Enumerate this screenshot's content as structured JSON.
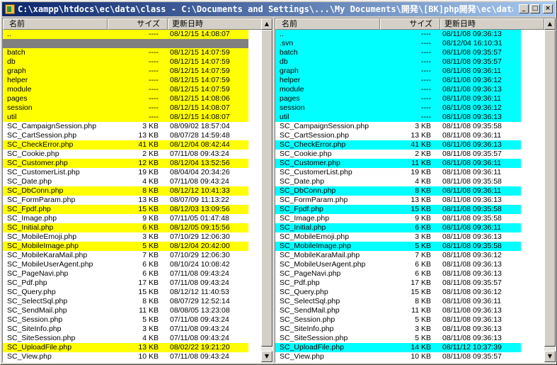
{
  "window": {
    "title": "C:\\xampp\\htdocs\\ec\\data\\class  - C:\\Documents and Settings\\...\\My Documents\\開発\\[BK]php開発\\ec\\data\\cla...",
    "minimize": "_",
    "maximize": "□",
    "close": "×"
  },
  "colors": {
    "left_highlight": "#ffff00",
    "right_highlight": "#00ffff",
    "selection": "#808080"
  },
  "headers": {
    "name": "名前",
    "size": "サイズ",
    "date": "更新日時"
  },
  "scroll": {
    "up": "▲",
    "down": "▼"
  },
  "left_rows": [
    {
      "name": "..",
      "size": "----",
      "date": "08/12/15 14:08:07",
      "hl": true
    },
    {
      "name": "",
      "size": "",
      "date": "",
      "sel": true
    },
    {
      "name": "batch",
      "size": "----",
      "date": "08/12/15 14:07:59",
      "hl": true
    },
    {
      "name": "db",
      "size": "----",
      "date": "08/12/15 14:07:59",
      "hl": true
    },
    {
      "name": "graph",
      "size": "----",
      "date": "08/12/15 14:07:59",
      "hl": true
    },
    {
      "name": "helper",
      "size": "----",
      "date": "08/12/15 14:07:59",
      "hl": true
    },
    {
      "name": "module",
      "size": "----",
      "date": "08/12/15 14:07:59",
      "hl": true
    },
    {
      "name": "pages",
      "size": "----",
      "date": "08/12/15 14:08:06",
      "hl": true
    },
    {
      "name": "session",
      "size": "----",
      "date": "08/12/15 14:08:07",
      "hl": true
    },
    {
      "name": "util",
      "size": "----",
      "date": "08/12/15 14:08:07",
      "hl": true
    },
    {
      "name": "SC_CampaignSession.php",
      "size": "3 KB",
      "date": "08/09/02 18:57:04",
      "hl": false
    },
    {
      "name": "SC_CartSession.php",
      "size": "13 KB",
      "date": "08/07/28 14:59:48",
      "hl": false
    },
    {
      "name": "SC_CheckError.php",
      "size": "41 KB",
      "date": "08/12/04 08:42:44",
      "hl": true
    },
    {
      "name": "SC_Cookie.php",
      "size": "2 KB",
      "date": "07/11/08 09:43:24",
      "hl": false
    },
    {
      "name": "SC_Customer.php",
      "size": "12 KB",
      "date": "08/12/04 13:52:56",
      "hl": true
    },
    {
      "name": "SC_CustomerList.php",
      "size": "19 KB",
      "date": "08/04/04 20:34:26",
      "hl": false
    },
    {
      "name": "SC_Date.php",
      "size": "4 KB",
      "date": "07/11/08 09:43:24",
      "hl": false
    },
    {
      "name": "SC_DbConn.php",
      "size": "8 KB",
      "date": "08/12/12 10:41:33",
      "hl": true
    },
    {
      "name": "SC_FormParam.php",
      "size": "13 KB",
      "date": "08/07/09 11:13:22",
      "hl": false
    },
    {
      "name": "SC_Fpdf.php",
      "size": "15 KB",
      "date": "08/12/03 13:09:56",
      "hl": true
    },
    {
      "name": "SC_Image.php",
      "size": "9 KB",
      "date": "07/11/05 01:47:48",
      "hl": false
    },
    {
      "name": "SC_Initial.php",
      "size": "6 KB",
      "date": "08/12/05 09:15:56",
      "hl": true
    },
    {
      "name": "SC_MobileEmoji.php",
      "size": "3 KB",
      "date": "07/10/29 12:06:30",
      "hl": false
    },
    {
      "name": "SC_MobileImage.php",
      "size": "5 KB",
      "date": "08/12/04 20:42:00",
      "hl": true
    },
    {
      "name": "SC_MobileKaraMail.php",
      "size": "7 KB",
      "date": "07/10/29 12:06:30",
      "hl": false
    },
    {
      "name": "SC_MobileUserAgent.php",
      "size": "6 KB",
      "date": "08/10/24 10:08:42",
      "hl": false
    },
    {
      "name": "SC_PageNavi.php",
      "size": "6 KB",
      "date": "07/11/08 09:43:24",
      "hl": false
    },
    {
      "name": "SC_Pdf.php",
      "size": "17 KB",
      "date": "07/11/08 09:43:24",
      "hl": false
    },
    {
      "name": "SC_Query.php",
      "size": "15 KB",
      "date": "08/12/12 11:40:53",
      "hl": false
    },
    {
      "name": "SC_SelectSql.php",
      "size": "8 KB",
      "date": "08/07/29 12:52:14",
      "hl": false
    },
    {
      "name": "SC_SendMail.php",
      "size": "11 KB",
      "date": "08/08/05 13:23:08",
      "hl": false
    },
    {
      "name": "SC_Session.php",
      "size": "5 KB",
      "date": "07/11/08 09:43:24",
      "hl": false
    },
    {
      "name": "SC_SiteInfo.php",
      "size": "3 KB",
      "date": "07/11/08 09:43:24",
      "hl": false
    },
    {
      "name": "SC_SiteSession.php",
      "size": "4 KB",
      "date": "07/11/08 09:43:24",
      "hl": false
    },
    {
      "name": "SC_UploadFile.php",
      "size": "13 KB",
      "date": "08/02/22 19:21:20",
      "hl": true
    },
    {
      "name": "SC_View.php",
      "size": "10 KB",
      "date": "07/11/08 09:43:24",
      "hl": false
    }
  ],
  "right_rows": [
    {
      "name": "..",
      "size": "----",
      "date": "08/11/08 09:36:13",
      "hl": true
    },
    {
      "name": ".svn",
      "size": "----",
      "date": "08/12/04 16:10:31",
      "hl": true
    },
    {
      "name": "batch",
      "size": "----",
      "date": "08/11/08 09:35:57",
      "hl": true
    },
    {
      "name": "db",
      "size": "----",
      "date": "08/11/08 09:35:57",
      "hl": true
    },
    {
      "name": "graph",
      "size": "----",
      "date": "08/11/08 09:36:11",
      "hl": true
    },
    {
      "name": "helper",
      "size": "----",
      "date": "08/11/08 09:36:12",
      "hl": true
    },
    {
      "name": "module",
      "size": "----",
      "date": "08/11/08 09:36:13",
      "hl": true
    },
    {
      "name": "pages",
      "size": "----",
      "date": "08/11/08 09:36:11",
      "hl": true
    },
    {
      "name": "session",
      "size": "----",
      "date": "08/11/08 09:36:12",
      "hl": true
    },
    {
      "name": "util",
      "size": "----",
      "date": "08/11/08 09:36:13",
      "hl": true
    },
    {
      "name": "SC_CampaignSession.php",
      "size": "3 KB",
      "date": "08/11/08 09:35:58",
      "hl": false
    },
    {
      "name": "SC_CartSession.php",
      "size": "13 KB",
      "date": "08/11/08 09:36:11",
      "hl": false
    },
    {
      "name": "SC_CheckError.php",
      "size": "41 KB",
      "date": "08/11/08 09:36:13",
      "hl": true
    },
    {
      "name": "SC_Cookie.php",
      "size": "2 KB",
      "date": "08/11/08 09:35:57",
      "hl": false
    },
    {
      "name": "SC_Customer.php",
      "size": "11 KB",
      "date": "08/11/08 09:36:11",
      "hl": true
    },
    {
      "name": "SC_CustomerList.php",
      "size": "19 KB",
      "date": "08/11/08 09:36:11",
      "hl": false
    },
    {
      "name": "SC_Date.php",
      "size": "4 KB",
      "date": "08/11/08 09:35:58",
      "hl": false
    },
    {
      "name": "SC_DbConn.php",
      "size": "8 KB",
      "date": "08/11/08 09:36:11",
      "hl": true
    },
    {
      "name": "SC_FormParam.php",
      "size": "13 KB",
      "date": "08/11/08 09:36:13",
      "hl": false
    },
    {
      "name": "SC_Fpdf.php",
      "size": "15 KB",
      "date": "08/11/08 09:35:58",
      "hl": true
    },
    {
      "name": "SC_Image.php",
      "size": "9 KB",
      "date": "08/11/08 09:35:58",
      "hl": false
    },
    {
      "name": "SC_Initial.php",
      "size": "6 KB",
      "date": "08/11/08 09:36:11",
      "hl": true
    },
    {
      "name": "SC_MobileEmoji.php",
      "size": "3 KB",
      "date": "08/11/08 09:36:13",
      "hl": false
    },
    {
      "name": "SC_MobileImage.php",
      "size": "5 KB",
      "date": "08/11/08 09:35:58",
      "hl": true
    },
    {
      "name": "SC_MobileKaraMail.php",
      "size": "7 KB",
      "date": "08/11/08 09:36:12",
      "hl": false
    },
    {
      "name": "SC_MobileUserAgent.php",
      "size": "6 KB",
      "date": "08/11/08 09:36:13",
      "hl": false
    },
    {
      "name": "SC_PageNavi.php",
      "size": "6 KB",
      "date": "08/11/08 09:36:13",
      "hl": false
    },
    {
      "name": "SC_Pdf.php",
      "size": "17 KB",
      "date": "08/11/08 09:35:57",
      "hl": false
    },
    {
      "name": "SC_Query.php",
      "size": "15 KB",
      "date": "08/11/08 09:36:12",
      "hl": false
    },
    {
      "name": "SC_SelectSql.php",
      "size": "8 KB",
      "date": "08/11/08 09:36:11",
      "hl": false
    },
    {
      "name": "SC_SendMail.php",
      "size": "11 KB",
      "date": "08/11/08 09:36:13",
      "hl": false
    },
    {
      "name": "SC_Session.php",
      "size": "5 KB",
      "date": "08/11/08 09:36:13",
      "hl": false
    },
    {
      "name": "SC_SiteInfo.php",
      "size": "3 KB",
      "date": "08/11/08 09:36:13",
      "hl": false
    },
    {
      "name": "SC_SiteSession.php",
      "size": "5 KB",
      "date": "08/11/08 09:36:13",
      "hl": false
    },
    {
      "name": "SC_UploadFile.php",
      "size": "14 KB",
      "date": "08/11/12 10:37:39",
      "hl": true
    },
    {
      "name": "SC_View.php",
      "size": "10 KB",
      "date": "08/11/08 09:35:57",
      "hl": false
    }
  ]
}
